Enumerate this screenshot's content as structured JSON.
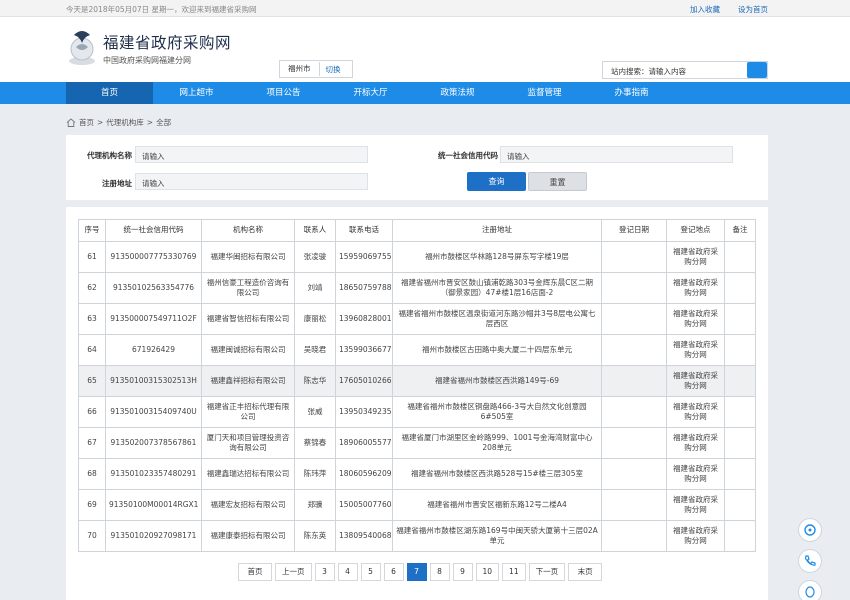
{
  "topbar": {
    "greeting": "今天是2018年05月07日 星期一，欢迎来到福建省采购网",
    "add_favorite": "加入收藏",
    "set_home": "设为首页"
  },
  "header": {
    "title": "福建省政府采购网",
    "subtitle": "中国政府采购网福建分网",
    "city": "福州市",
    "switch": "切换",
    "search_text": "站内搜索：请输入内容"
  },
  "nav": [
    "首页",
    "网上超市",
    "项目公告",
    "开标大厅",
    "政策法规",
    "监督管理",
    "办事指南"
  ],
  "breadcrumb": {
    "home": "首页",
    "sep": ">",
    "level1": "代理机构库",
    "level2": "全部"
  },
  "filter": {
    "name_label": "代理机构名称",
    "name_value": "请输入",
    "credit_label": "统一社会信用代码",
    "credit_value": "请输入",
    "address_label": "注册地址",
    "address_value": "请输入",
    "query": "查询",
    "reset": "重置"
  },
  "table": {
    "headers": [
      "序号",
      "统一社会信用代码",
      "机构名称",
      "联系人",
      "联系电话",
      "注册地址",
      "登记日期",
      "登记地点",
      "备注"
    ],
    "rows": [
      [
        "61",
        "913500007775330769",
        "福建华闽招标有限公司",
        "张凌骏",
        "15959069755",
        "福州市鼓楼区华林路128号屏东写字楼19层",
        "",
        "福建省政府采购分网",
        ""
      ],
      [
        "62",
        "91350102563354776",
        "福州信豪工程造价咨询有限公司",
        "刘靖",
        "18650759788",
        "福建省福州市晋安区鼓山镇浦乾路303号金辉东晨C区二期（御景家园）47#楼1层16店面-2",
        "",
        "福建省政府采购分网",
        ""
      ],
      [
        "63",
        "913500007549711O2F",
        "福建省智信招标有限公司",
        "康丽松",
        "13960828001",
        "福建省福州市鼓楼区温泉街道河东路沙帽井3号8层电公寓七层西区",
        "",
        "福建省政府采购分网",
        ""
      ],
      [
        "64",
        "671926429",
        "福建闽诚招标有限公司",
        "吴晓君",
        "13599036677",
        "福州市鼓楼区古田路中奥大厦二十四层东单元",
        "",
        "福建省政府采购分网",
        ""
      ],
      [
        "65",
        "91350100315302513H",
        "福建鑫祥招标有限公司",
        "陈志华",
        "17605010266",
        "福建省福州市鼓楼区西洪路149号-69",
        "",
        "福建省政府采购分网",
        ""
      ],
      [
        "66",
        "91350100315409740U",
        "福建省正丰招标代理有限公司",
        "张威",
        "13950349235",
        "福建省福州市鼓楼区铜盘路466-3号大自然文化创意园6#505室",
        "",
        "福建省政府采购分网",
        ""
      ],
      [
        "67",
        "913502007378567861",
        "厦门天和项目管理投资咨询有限公司",
        "蔡锦春",
        "18906005577",
        "福建省厦门市湖里区金岭路999、1001号金海湾财富中心208单元",
        "",
        "福建省政府采购分网",
        ""
      ],
      [
        "68",
        "913501023357480291",
        "福建鑫瑞达招标有限公司",
        "陈玮萍",
        "18060596209",
        "福建省福州市鼓楼区西洪路528号15#楼三层305室",
        "",
        "福建省政府采购分网",
        ""
      ],
      [
        "69",
        "91350100M00014RGX1",
        "福建宏友招标有限公司",
        "郑骥",
        "15005007760",
        "福建省福州市晋安区福新东路12号二楼A4",
        "",
        "福建省政府采购分网",
        ""
      ],
      [
        "70",
        "913501020927098171",
        "福建康泰招标有限公司",
        "陈东英",
        "13809540068",
        "福建省福州市鼓楼区湖东路169号中闽天骄大厦第十三层02A单元",
        "",
        "福建省政府采购分网",
        ""
      ]
    ]
  },
  "pager": [
    "首页",
    "上一页",
    "3",
    "4",
    "5",
    "6",
    "7",
    "8",
    "9",
    "10",
    "11",
    "下一页",
    "末页"
  ],
  "pager_active": "7",
  "colors": {
    "nav": "#1e8ce6",
    "nav_active": "#1565b0",
    "primary_button": "#1e6fc6",
    "link": "#1a6ab8"
  }
}
